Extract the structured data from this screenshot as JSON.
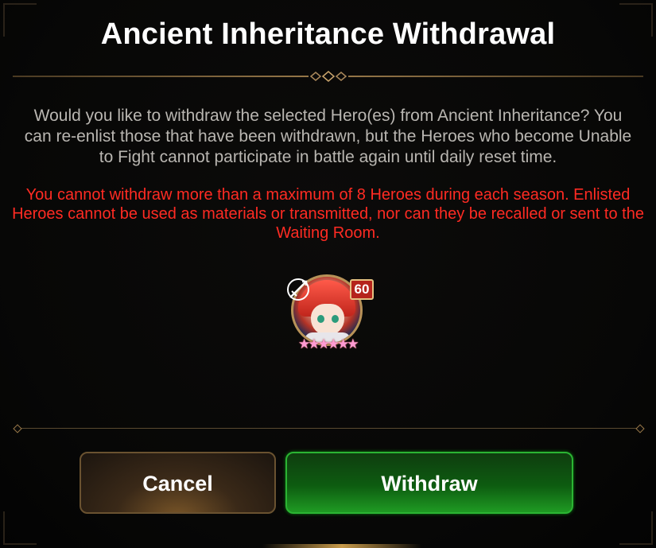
{
  "dialog": {
    "title": "Ancient Inheritance Withdrawal",
    "description": "Would you like to withdraw the selected Hero(es) from Ancient Inheritance? You can re-enlist those that have been withdrawn, but the Heroes who become Unable to Fight cannot participate in battle again until daily reset time.",
    "warning": "You cannot withdraw more than a maximum of 8 Heroes during each season. Enlisted Heroes cannot be used as materials or transmitted, nor can they be recalled or sent to the Waiting Room."
  },
  "hero": {
    "level": "60",
    "stars": "★★★★★★",
    "class_icon": "ranger-class-icon"
  },
  "buttons": {
    "cancel": "Cancel",
    "withdraw": "Withdraw"
  },
  "colors": {
    "warning_text": "#ff2b23",
    "withdraw_button": "#1f9a23",
    "level_badge": "#b5241c"
  }
}
